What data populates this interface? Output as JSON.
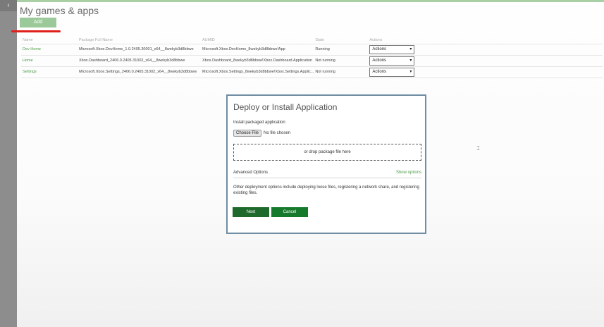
{
  "page": {
    "title": "My games & apps",
    "add_label": "Add"
  },
  "table": {
    "headers": [
      "Name",
      "Package Full Name",
      "AUMID",
      "State",
      "Actions"
    ],
    "rows": [
      {
        "name": "Dev Home",
        "package": "Microsoft.Xbox.DevHome_1.0.2405.30001_x64__8wekyb3d8bbwe",
        "aumid": "Microsoft.Xbox.DevHome_8wekyb3d8bbwe!App",
        "state": "Running",
        "action": "Actions"
      },
      {
        "name": "Home",
        "package": "Xbox.Dashboard_2406.0.2405.31002_x64__8wekyb3d8bbwe",
        "aumid": "Xbox.Dashboard_8wekyb3d8bbwe!Xbox.Dashboard.Application",
        "state": "Not running",
        "action": "Actions"
      },
      {
        "name": "Settings",
        "package": "Microsoft.Xbox.Settings_2406.0.2405.31002_x64__8wekyb3d8bbwe",
        "aumid": "Microsoft.Xbox.Settings_8wekyb3d8bbwe!Xbox.Settings.Applic...",
        "state": "Not running",
        "action": "Actions"
      }
    ]
  },
  "dialog": {
    "title": "Deploy or Install Application",
    "install_label": "Install packaged application",
    "choose_file": "Choose File",
    "no_file": "No file chosen",
    "drop_text": "or drop package file here",
    "advanced_label": "Advanced Options",
    "show_options": "Show options",
    "advanced_desc": "Other deployment options include deploying loose files, registering a network share, and registering existing files.",
    "next_label": "Next",
    "cancel_label": "Cancel"
  },
  "colors": {
    "accent": "#4a9b47",
    "add_button": "#9bc999",
    "next_button": "#1e6a2c",
    "annotation": "#e0201a"
  }
}
